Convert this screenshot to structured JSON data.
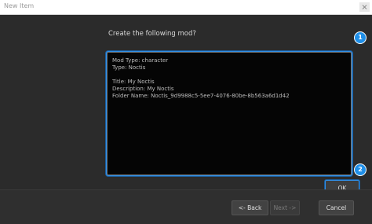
{
  "window": {
    "title": "New Item"
  },
  "dialog": {
    "prompt": "Create the following mod?",
    "summary_lines": [
      "Mod Type: character",
      "Type: Noctis",
      "",
      "Title: My Noctis",
      "Description: My Noctis",
      "Folder Name: Noctis_9d9988c5-5ee7-4076-80be-8b563a6d1d42"
    ],
    "ok_label": "OK",
    "badges": [
      "1",
      "2"
    ]
  },
  "footer": {
    "back_label": "<- Back",
    "next_label": "Next ->",
    "cancel_label": "Cancel"
  },
  "colors": {
    "accent": "#1f8fe8",
    "background": "#2b2b2b",
    "summary_background": "#050505"
  },
  "icons": {
    "close": "close-icon"
  }
}
